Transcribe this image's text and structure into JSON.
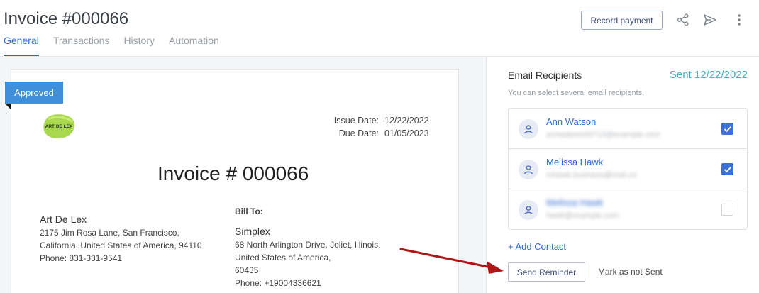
{
  "header": {
    "title": "Invoice #000066",
    "tabs": [
      {
        "label": "General",
        "active": true
      },
      {
        "label": "Transactions",
        "active": false
      },
      {
        "label": "History",
        "active": false
      },
      {
        "label": "Automation",
        "active": false
      }
    ],
    "record_payment_label": "Record payment",
    "icons": [
      "share-icon",
      "send-icon",
      "more-vertical-icon"
    ]
  },
  "invoice": {
    "status_badge": "Approved",
    "logo_text": "ART DE LEX",
    "issue_date_label": "Issue Date:",
    "issue_date": "12/22/2022",
    "due_date_label": "Due Date:",
    "due_date": "01/05/2023",
    "title": "Invoice # 000066",
    "from": {
      "name": "Art De Lex",
      "line1": "2175 Jim Rosa Lane, San Francisco,",
      "line2": "California, United States of America, 94110",
      "phone": "Phone: 831-331-9541"
    },
    "bill_to_label": "Bill To:",
    "bill_to": {
      "name": "Simplex",
      "line1": "68 North Arlington Drive, Joliet, Illinois,",
      "line2": "United States of America,",
      "line3": "60435",
      "phone": "Phone: +19004336621"
    }
  },
  "email_panel": {
    "title": "Email Recipients",
    "sent_status": "Sent 12/22/2022",
    "hint": "You can select several email recipients.",
    "recipients": [
      {
        "name": "Ann Watson",
        "email": "annwatson00713@example.com",
        "checked": true
      },
      {
        "name": "Melissa Hawk",
        "email": "mhawk.business@mail.co",
        "checked": true
      },
      {
        "name": "Melissa Hawk",
        "email": "hawk@example.com",
        "checked": false
      }
    ],
    "add_contact_label": "+ Add Contact",
    "send_reminder_label": "Send Reminder",
    "mark_not_sent_label": "Mark as not Sent"
  },
  "colors": {
    "accent": "#2d6ad6",
    "badge": "#3f8fd9",
    "sent": "#3cb4c8",
    "checkbox": "#3e6fd8",
    "arrow": "#b01515"
  }
}
